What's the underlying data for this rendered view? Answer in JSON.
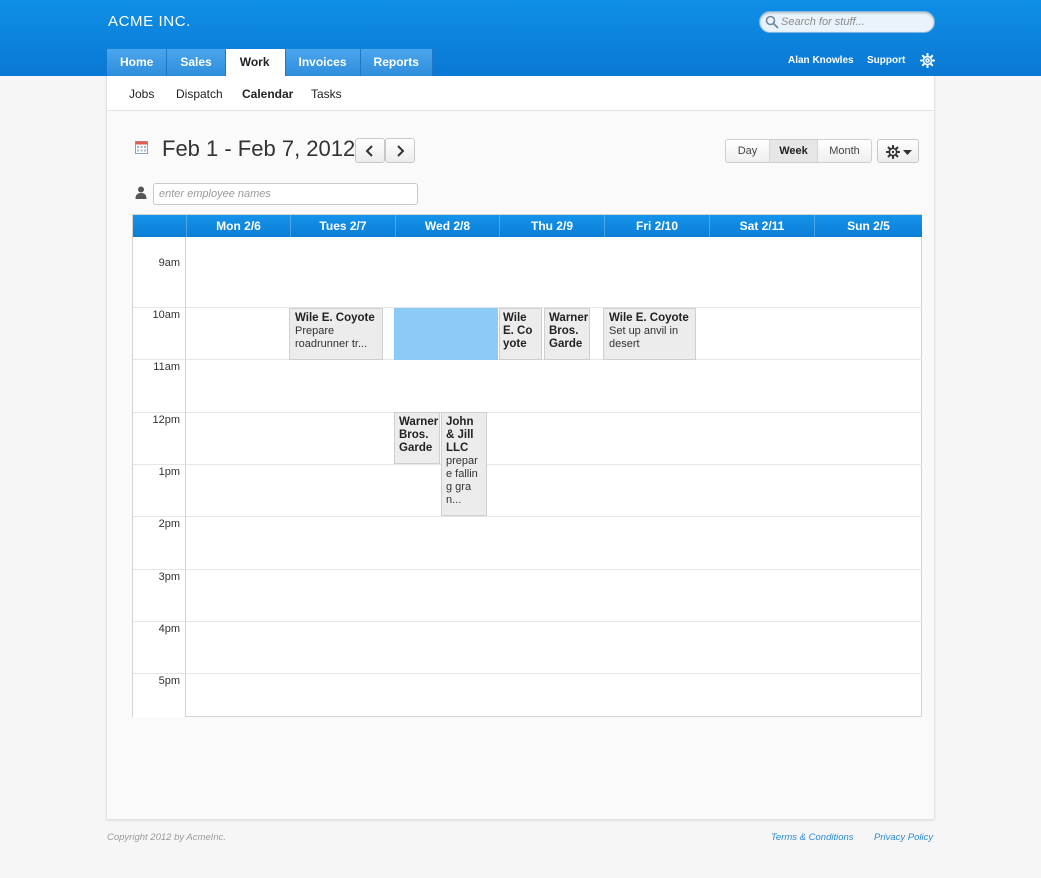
{
  "header": {
    "brand": "ACME INC.",
    "search_placeholder": "Search for stuff...",
    "tabs": [
      {
        "label": "Home"
      },
      {
        "label": "Sales"
      },
      {
        "label": "Work",
        "active": true
      },
      {
        "label": "Invoices"
      },
      {
        "label": "Reports"
      }
    ],
    "user_name": "Alan Knowles",
    "support_label": "Support",
    "accent_color": "#0a82dc"
  },
  "subnav": {
    "items": [
      {
        "label": "Jobs"
      },
      {
        "label": "Dispatch"
      },
      {
        "label": "Calendar",
        "active": true
      },
      {
        "label": "Tasks"
      }
    ]
  },
  "toolbar": {
    "date_range": "Feb 1 - Feb 7, 2012",
    "view_buttons": [
      {
        "label": "Day"
      },
      {
        "label": "Week",
        "active": true
      },
      {
        "label": "Month"
      }
    ],
    "employee_placeholder": "enter employee names"
  },
  "calendar": {
    "days": [
      "Mon 2/6",
      "Tues 2/7",
      "Wed 2/8",
      "Thu 2/9",
      "Fri 2/10",
      "Sat 2/11",
      "Sun 2/5"
    ],
    "hours": [
      "9am",
      "10am",
      "11am",
      "12pm",
      "1pm",
      "2pm",
      "3pm",
      "4pm",
      "5pm"
    ],
    "events": [
      {
        "title": "Wile E. Coyote",
        "body": "Prepare roadrunner tr..."
      },
      {
        "title": "Wile E. Coyote",
        "body": ""
      },
      {
        "title": "Warner Bros. Garde",
        "body": ""
      },
      {
        "title": "Wile E. Coyote",
        "body": "Set up anvil in desert"
      },
      {
        "title": "Warner Bros. Garde",
        "body": ""
      },
      {
        "title": "John & Jill LLC",
        "body": "prepare falling gran..."
      }
    ],
    "selection_color": "#8ccbf7"
  },
  "footer": {
    "copyright": "Copyright 2012 by AcmeInc.",
    "terms": "Terms & Conditions",
    "privacy": "Privacy Policy"
  }
}
